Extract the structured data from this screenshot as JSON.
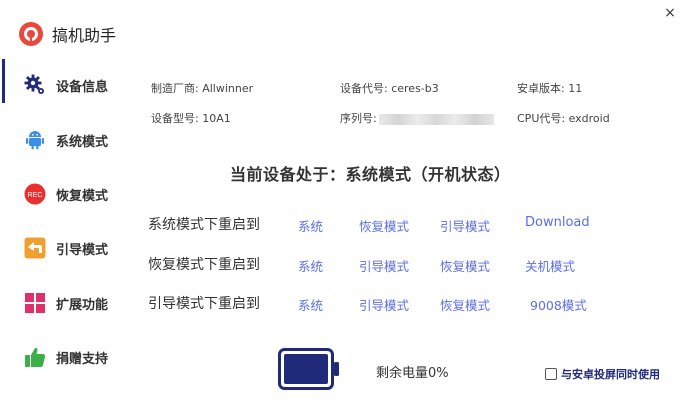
{
  "app": {
    "title": "搞机助手",
    "close_glyph": "×"
  },
  "sidebar": {
    "items": [
      {
        "label": "设备信息",
        "icon": "gear-icon",
        "active": true
      },
      {
        "label": "系统模式",
        "icon": "android-icon"
      },
      {
        "label": "恢复模式",
        "icon": "rec-icon",
        "icon_text": "REC"
      },
      {
        "label": "引导模式",
        "icon": "back-arrow-icon"
      },
      {
        "label": "扩展功能",
        "icon": "grid-icon"
      },
      {
        "label": "捐赠支持",
        "icon": "thumbs-up-icon"
      }
    ]
  },
  "device_info": {
    "manufacturer": "制造厂商: Allwinner",
    "codename": "设备代号: ceres-b3",
    "android_version": "安卓版本: 11",
    "model": "设备型号: 10A1",
    "serial_label": "序列号:",
    "cpu": "CPU代号: exdroid"
  },
  "status_text": "当前设备处于：系统模式（开机状态）",
  "reboot_rows": [
    {
      "label": "系统模式下重启到",
      "targets": [
        "系统",
        "恢复模式",
        "引导模式",
        "Download"
      ]
    },
    {
      "label": "恢复模式下重启到",
      "targets": [
        "系统",
        "引导模式",
        "恢复模式",
        "关机模式"
      ]
    },
    {
      "label": "引导模式下重启到",
      "targets": [
        "系统",
        "引导模式",
        "恢复模式",
        "9008模式"
      ]
    }
  ],
  "battery": {
    "text": "剩余电量0%",
    "level": 0.0
  },
  "sync_option": {
    "label": "与安卓投屏同时使用",
    "checked": false
  },
  "colors": {
    "accent": "#1f2a7a",
    "link": "#5b6ee8",
    "logo": "#e8493c",
    "rec": "#e8312f",
    "back": "#f0a030",
    "grid": "#e0306a",
    "thumb": "#3bb048",
    "android": "#3a8ee6"
  }
}
